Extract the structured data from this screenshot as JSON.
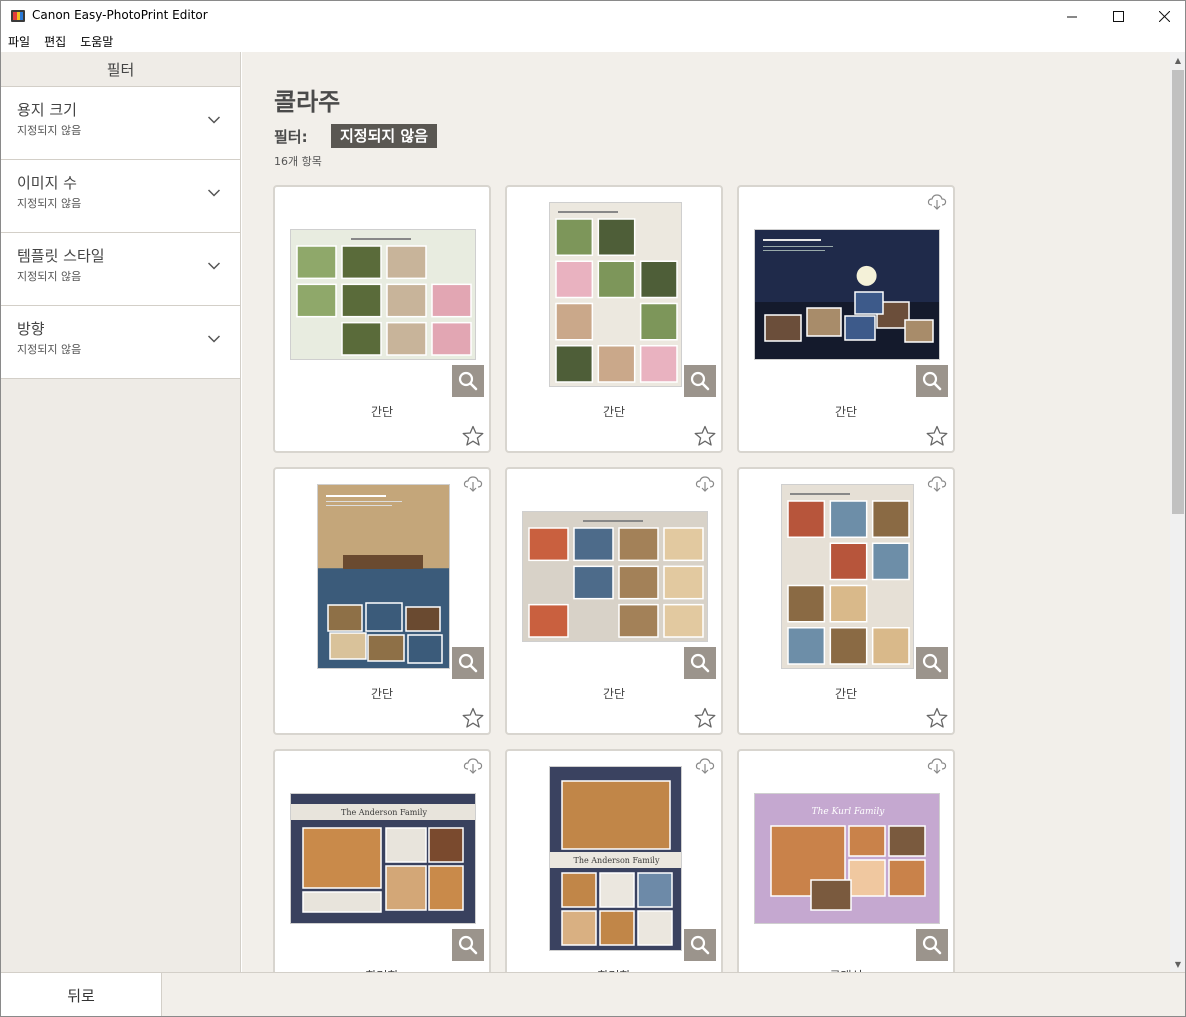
{
  "window": {
    "title": "Canon Easy-PhotoPrint Editor",
    "minimize_glyph": "—",
    "maximize_glyph": "☐",
    "close_glyph": "✕"
  },
  "menu": {
    "items": [
      "파일",
      "편집",
      "도움말"
    ]
  },
  "sidebar": {
    "header": "필터",
    "filters": [
      {
        "title": "용지 크기",
        "value": "지정되지 않음"
      },
      {
        "title": "이미지 수",
        "value": "지정되지 않음"
      },
      {
        "title": "템플릿 스타일",
        "value": "지정되지 않음"
      },
      {
        "title": "방향",
        "value": "지정되지 않음"
      }
    ]
  },
  "main": {
    "title": "콜라주",
    "filter_label": "필터:",
    "filter_value": "지정되지 않음",
    "item_count": "16개 항목",
    "cards": [
      {
        "label": "간단",
        "cloud": false,
        "theme": "grass-landscape",
        "palette": [
          "#e8ece0",
          "#8fa86a",
          "#5a6b3a",
          "#c8b49a",
          "#e2a6b3"
        ]
      },
      {
        "label": "간단",
        "cloud": false,
        "theme": "grass-portrait",
        "palette": [
          "#ece8df",
          "#7d965a",
          "#4e5e38",
          "#caa88a",
          "#e9b2c0"
        ]
      },
      {
        "label": "간단",
        "cloud": true,
        "theme": "night-sky",
        "palette": [
          "#1f2a4a",
          "#3d5a8a",
          "#f4f1d8",
          "#6b4e3a",
          "#a88c6a"
        ]
      },
      {
        "label": "간단",
        "cloud": true,
        "theme": "canoe",
        "palette": [
          "#c4a67a",
          "#8e7047",
          "#3b5b7a",
          "#6a4a30",
          "#d9c29a"
        ]
      },
      {
        "label": "간단",
        "cloud": true,
        "theme": "family-tiles",
        "palette": [
          "#d8d2c8",
          "#c9603f",
          "#4d6b8a",
          "#a38158",
          "#e2c9a0"
        ]
      },
      {
        "label": "간단",
        "cloud": true,
        "theme": "family-portrait",
        "palette": [
          "#e6e0d6",
          "#b7553b",
          "#6d8ea8",
          "#8a6a44",
          "#d9b98a"
        ]
      },
      {
        "label": "화려한",
        "cloud": true,
        "theme": "navy-family",
        "banner": "The Anderson Family",
        "palette": [
          "#39415e",
          "#c98a4a",
          "#e8e4dc",
          "#7a4a2e",
          "#d3a777"
        ]
      },
      {
        "label": "화려한",
        "cloud": true,
        "theme": "navy-family-portrait",
        "banner": "The Anderson Family",
        "palette": [
          "#3a4260",
          "#c18648",
          "#ebe7df",
          "#6d8aa8",
          "#d9b082"
        ]
      },
      {
        "label": "클래식",
        "cloud": true,
        "theme": "lilac-family",
        "banner": "The Kurl Family",
        "palette": [
          "#c5a8d0",
          "#e9ddee",
          "#c9824a",
          "#7a5a3e",
          "#f0c8a0"
        ]
      }
    ]
  },
  "footer": {
    "back_label": "뒤로"
  },
  "colors": {
    "sidebar_bg": "#eeebe6",
    "main_bg": "#f2efea",
    "badge_bg": "#5a5752",
    "zoom_btn_bg": "#9b948c"
  },
  "icons": [
    "chevron-down-icon",
    "search-icon",
    "star-icon",
    "cloud-download-icon",
    "app-icon"
  ]
}
